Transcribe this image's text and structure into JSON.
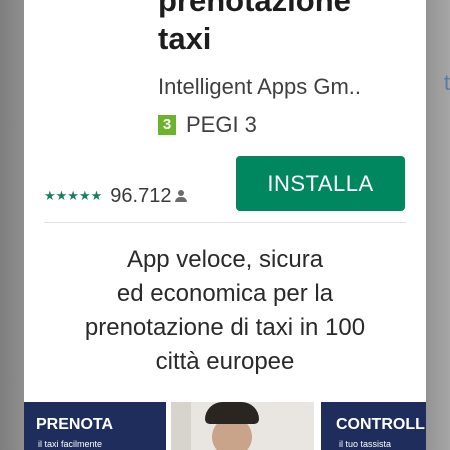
{
  "app": {
    "title_lines": [
      "prenotazione",
      "taxi"
    ],
    "developer": "Intelligent Apps Gm..",
    "pegi_icon": "3",
    "pegi_label": "PEGI 3"
  },
  "rating": {
    "stars": "★★★★★",
    "count": "96.712"
  },
  "install_button": {
    "label": "INSTALLA",
    "color": "#01875f"
  },
  "description_lines": [
    "App veloce, sicura",
    "ed economica per la",
    "prenotazione di taxi in 100",
    "città europee"
  ],
  "screenshots": [
    {
      "title": "PRENOTA",
      "subtitle": "il taxi facilmente"
    },
    {
      "title": "",
      "subtitle": ""
    },
    {
      "title": "CONTROLL",
      "subtitle": "il tuo tassista"
    }
  ],
  "background_right_text": "t",
  "colors": {
    "accent": "#01875f",
    "star": "#1a7f5a",
    "screenshot_bg": "#1f2d5c"
  }
}
